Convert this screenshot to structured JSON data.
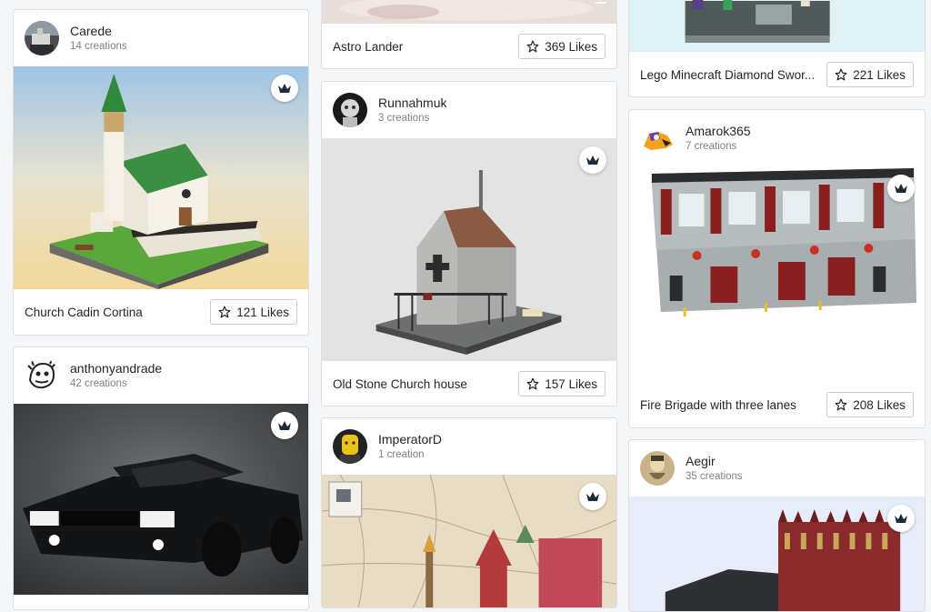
{
  "column1": {
    "card1": {
      "user": "Carede",
      "creations": "14 creations",
      "title": "Church Cadin Cortina",
      "likes": "121 Likes",
      "badge_icon": "crown-icon"
    },
    "card2": {
      "user": "anthonyandrade",
      "creations": "42 creations",
      "badge_icon": "crown-icon"
    }
  },
  "column2": {
    "card0": {
      "title": "Astro Lander",
      "likes": "369 Likes",
      "download_icon": "download-icon"
    },
    "card1": {
      "user": "Runnahmuk",
      "creations": "3 creations",
      "title": "Old Stone Church house",
      "likes": "157 Likes",
      "badge_icon": "crown-icon"
    },
    "card2": {
      "user": "ImperatorD",
      "creations": "1 creation",
      "badge_icon": "crown-icon"
    }
  },
  "column3": {
    "card0": {
      "title": "Lego Minecraft Diamond Swor...",
      "likes": "221 Likes"
    },
    "card1": {
      "user": "Amarok365",
      "creations": "7 creations",
      "title": "Fire Brigade with three lanes",
      "likes": "208 Likes",
      "badge_icon": "crown-icon"
    },
    "card2": {
      "user": "Aegir",
      "creations": "35 creations",
      "badge_icon": "crown-icon"
    }
  },
  "colors": {
    "text": "#1f2429",
    "muted": "#7b8289",
    "border": "#dcdfe3",
    "crown": "#1c2a3a"
  }
}
